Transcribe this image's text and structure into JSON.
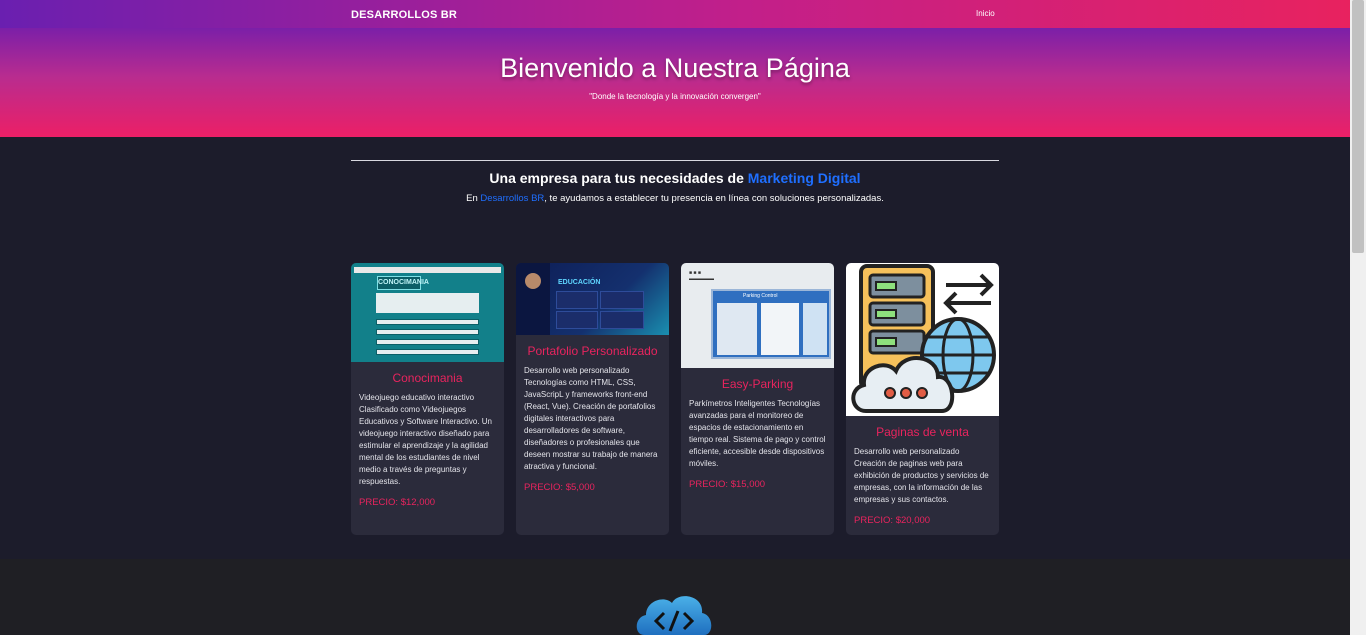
{
  "nav": {
    "brand": "DESARROLLOS BR",
    "link_home": "Inicio"
  },
  "hero": {
    "title": "Bienvenido a Nuestra Página",
    "subtitle": "\"Donde la tecnología y la innovación convergen\""
  },
  "intro": {
    "title_prefix": "Una empresa para tus necesidades de ",
    "title_accent": "Marketing Digital",
    "text_prefix": "En ",
    "text_accent": "Desarrollos BR",
    "text_suffix": ", te ayudamos a establecer tu presencia en línea con soluciones personalizadas."
  },
  "screenshots": {
    "game_logo": "CONOCIMANIA",
    "edu_title": "EDUCACIÓN",
    "park_header": "Parking Control"
  },
  "cards": [
    {
      "title": "Conocimania",
      "description": "Videojuego educativo interactivo Clasificado como Videojuegos Educativos y Software Interactivo. Un videojuego interactivo diseñado para estimular el aprendizaje y la agilidad mental de los estudiantes de nivel medio a través de preguntas y respuestas.",
      "price": "PRECIO: $12,000"
    },
    {
      "title": "Portafolio Personalizado",
      "description": "Desarrollo web personalizado Tecnologías como HTML, CSS, JavaScripL y frameworks front-end (React, Vue). Creación de portafolios digitales interactivos para desarrolladores de software, diseñadores o profesionales que deseen mostrar su trabajo de manera atractiva y funcional.",
      "price": "PRECIO: $5,000"
    },
    {
      "title": "Easy-Parking",
      "description": "Parkímetros Inteligentes Tecnologías avanzadas para el monitoreo de espacios de estacionamiento en tiempo real. Sistema de pago y control eficiente, accesible desde dispositivos móviles.",
      "price": "PRECIO: $15,000"
    },
    {
      "title": "Paginas de venta",
      "description": "Desarrollo web personalizado Creación de paginas web para exhibición de productos y servicios de empresas, con la información de las empresas y sus contactos.",
      "price": "PRECIO: $20,000"
    }
  ],
  "colors": {
    "accent_pink": "#e8245e",
    "accent_blue": "#1f6fff",
    "card_bg": "#2b2b3b",
    "page_bg": "#1c1c2b"
  },
  "icons": {
    "footer": "cloud-code-icon",
    "card4": "server-cloud-globe-icon"
  }
}
